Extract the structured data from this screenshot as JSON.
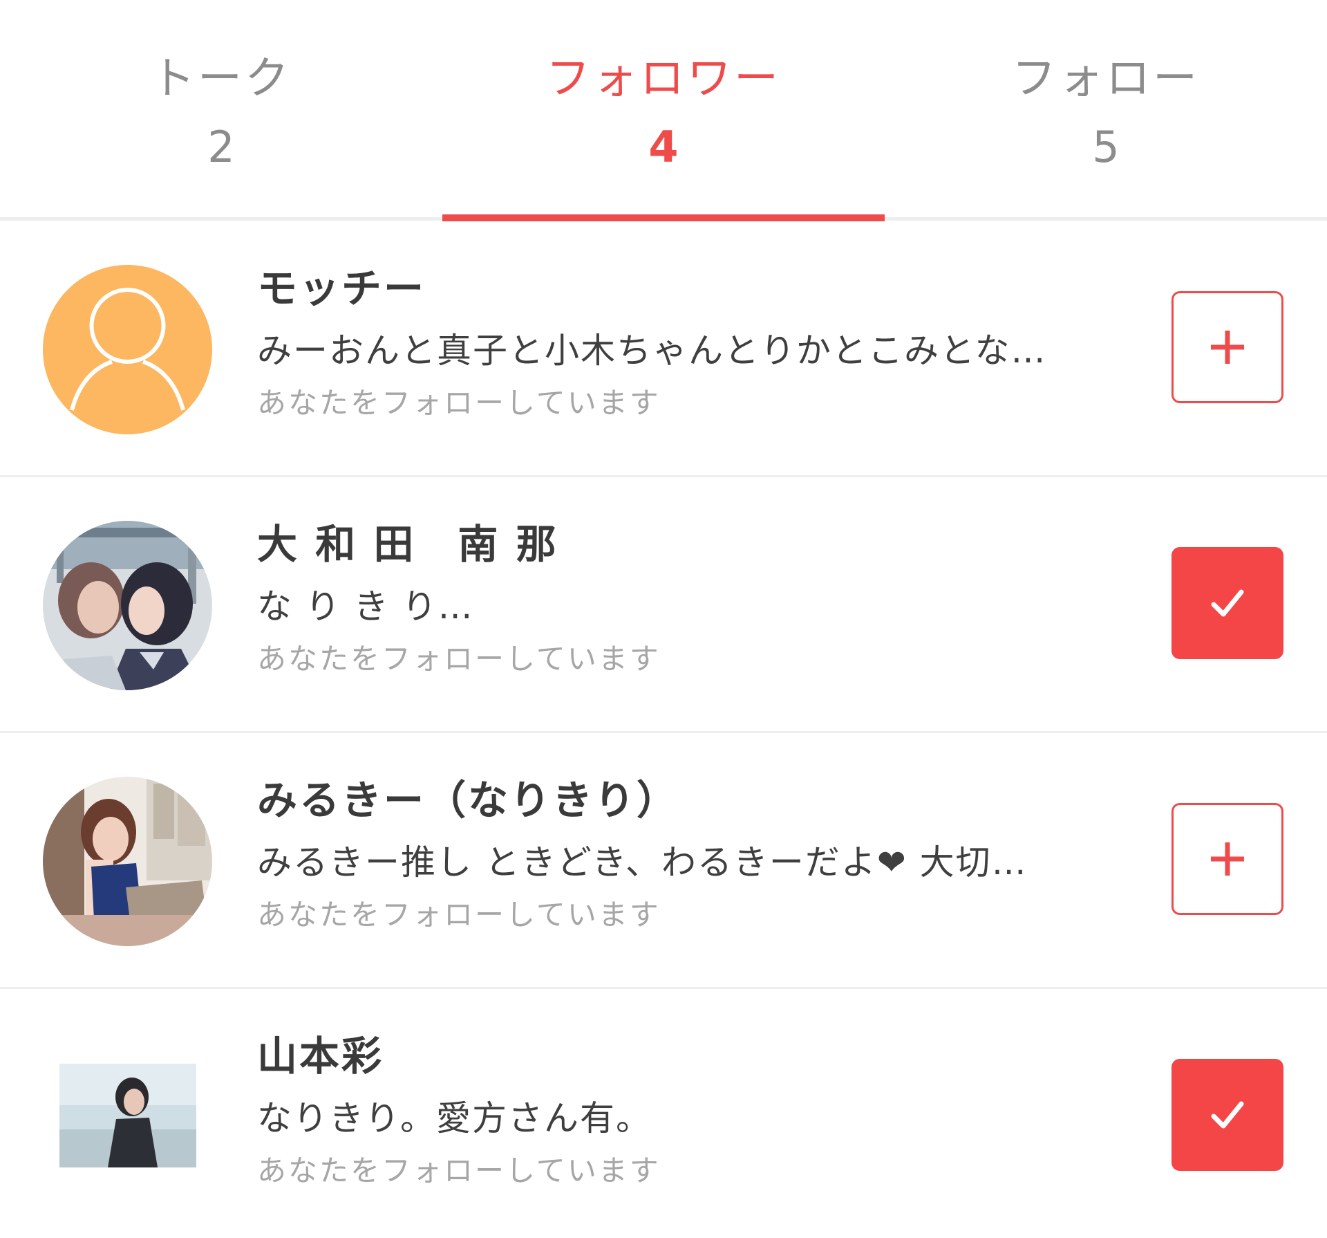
{
  "colors": {
    "accent": "#ef4b4b",
    "inactive_text": "#8c8c8c",
    "default_avatar": "#fdb760"
  },
  "tabs": [
    {
      "label": "トーク",
      "count": "2",
      "active": false
    },
    {
      "label": "フォロワー",
      "count": "4",
      "active": true
    },
    {
      "label": "フォロー",
      "count": "5",
      "active": false
    }
  ],
  "followers": [
    {
      "name": "モッチー",
      "bio": "みーおんと真子と小木ちゃんとりかとこみとな…",
      "status": "あなたをフォローしています",
      "avatar": "default-person-icon",
      "follow_state": "not-following",
      "button_icon": "plus-icon"
    },
    {
      "name": "大 和 田　南 那",
      "bio": "な り き り…",
      "status": "あなたをフォローしています",
      "avatar": "photo",
      "follow_state": "following",
      "button_icon": "check-icon"
    },
    {
      "name": "みるきー（なりきり）",
      "bio": "みるきー推し ときどき、わるきーだよ❤ 大切…",
      "status": "あなたをフォローしています",
      "avatar": "photo",
      "follow_state": "not-following",
      "button_icon": "plus-icon"
    },
    {
      "name": "山本彩",
      "bio": "なりきり。愛方さん有。",
      "status": "あなたをフォローしています",
      "avatar": "photo",
      "follow_state": "following",
      "button_icon": "check-icon"
    }
  ]
}
